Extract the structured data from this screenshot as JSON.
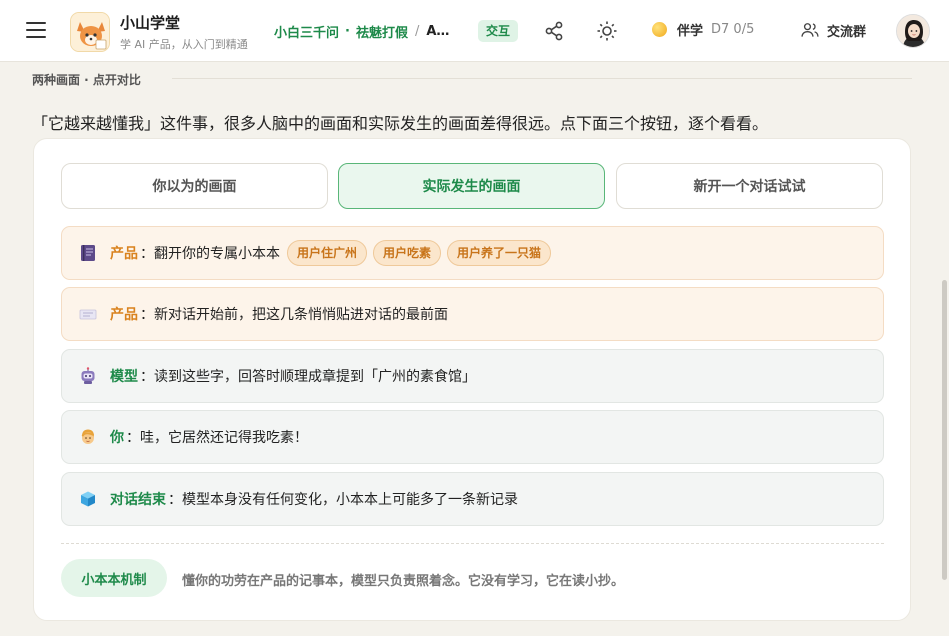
{
  "header": {
    "brand_title": "小山学堂",
    "brand_sub": "学 AI 产品，从入门到精通",
    "crumbs": [
      "小白三千问",
      "祛魅打假",
      "A…"
    ],
    "crumb_dot": "·",
    "crumb_sep": "/",
    "badge": "交互",
    "pal_label": "伴学",
    "pal_count": "D7 0/5",
    "community": "交流群",
    "icons": [
      "menu-icon",
      "share-icon",
      "sun-icon",
      "coin-icon",
      "users-icon"
    ]
  },
  "section": {
    "title": "两种画面 · 点开对比",
    "intro": "「它越来越懂我」这件事，很多人脑中的画面和实际发生的画面差得很远。点下面三个按钮，逐个看看。"
  },
  "tabs": [
    {
      "label": "你以为的画面",
      "active": false
    },
    {
      "label": "实际发生的画面",
      "active": true
    },
    {
      "label": "新开一个对话试试",
      "active": false
    }
  ],
  "steps": [
    {
      "who": "产品",
      "text": "：翻开你的专属小本本",
      "tone": "warm",
      "icon": "notebook-icon",
      "chips": [
        "用户住广州",
        "用户吃素",
        "用户养了一只猫"
      ]
    },
    {
      "who": "产品",
      "text": "：新对话开始前，把这几条悄悄贴进对话的最前面",
      "tone": "warm",
      "icon": "sticky-note-icon",
      "chips": []
    },
    {
      "who": "模型",
      "text": "：读到这些字，回答时顺理成章提到「广州的素食馆」",
      "tone": "cool",
      "icon": "robot-icon",
      "chips": []
    },
    {
      "who": "你",
      "text": "：哇，它居然还记得我吃素！",
      "tone": "cool",
      "icon": "person-face-icon",
      "chips": []
    },
    {
      "who": "对话结束",
      "text": "：模型本身没有任何变化，小本本上可能多了一条新记录",
      "tone": "cool",
      "icon": "cube-icon",
      "chips": []
    }
  ],
  "mechanism": {
    "button": "小本本机制",
    "text": "懂你的功劳在产品的记事本，模型只负责照着念。它没有学习，它在读小抄。"
  },
  "colors": {
    "accent_green": "#1e8a4a",
    "accent_orange": "#d9821e",
    "warm_bg": "#fdf4ea",
    "cool_bg": "#f3f5f4"
  }
}
